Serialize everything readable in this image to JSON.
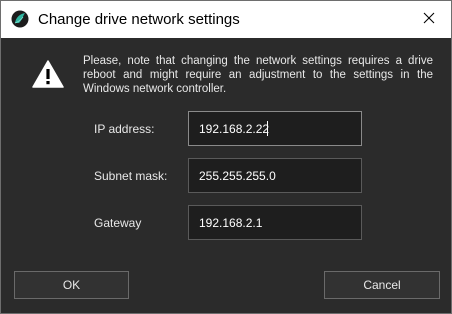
{
  "window": {
    "title": "Change drive network settings",
    "app_icon": "drive-logo-icon",
    "close_icon": "close-icon"
  },
  "notice": {
    "icon": "warning-icon",
    "text": "Please, note that changing the network settings requires a drive reboot and might require an adjustment to the settings in the Windows network controller."
  },
  "form": {
    "ip_label": "IP address:",
    "ip_value": "192.168.2.22",
    "subnet_label": "Subnet mask:",
    "subnet_value": "255.255.255.0",
    "gateway_label": "Gateway",
    "gateway_value": "192.168.2.1"
  },
  "buttons": {
    "ok_label": "OK",
    "cancel_label": "Cancel"
  },
  "colors": {
    "background": "#2b2b2b",
    "input_background": "#1e1e1e",
    "text": "#e8e8e8",
    "logo_teal": "#2fb5a0"
  }
}
